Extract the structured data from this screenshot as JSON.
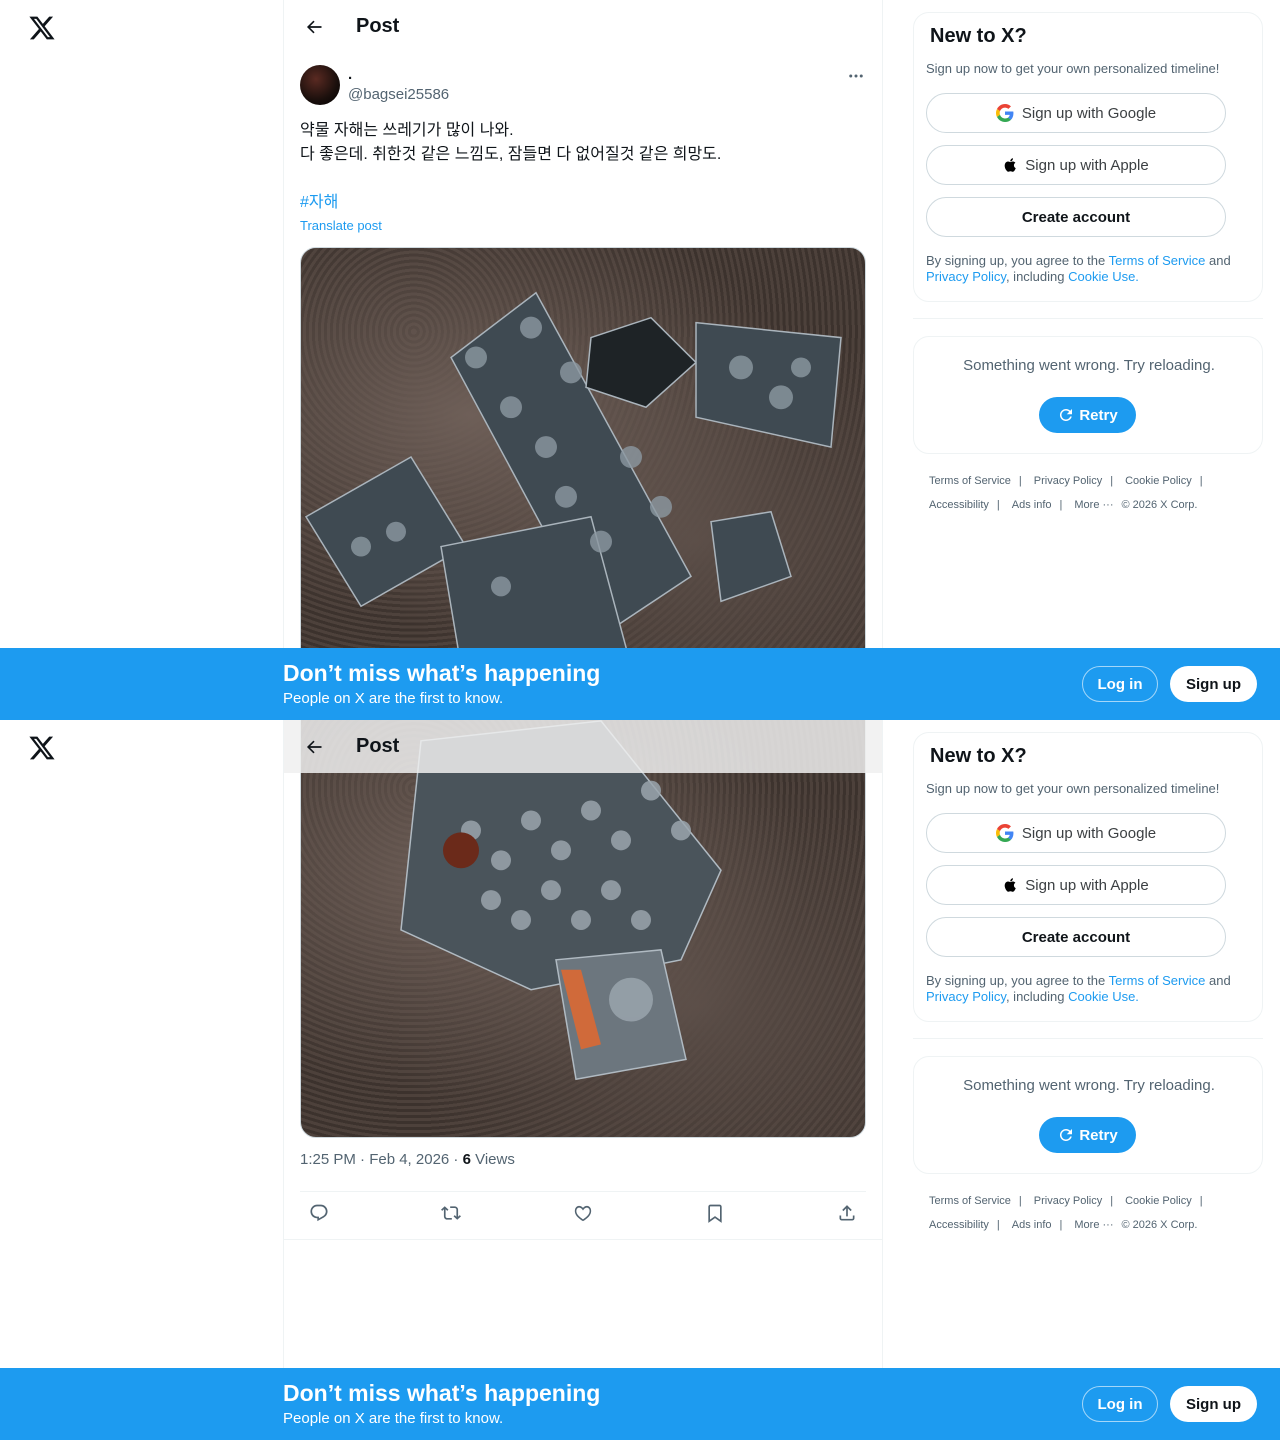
{
  "header": {
    "title": "Post"
  },
  "post": {
    "author_name": ".",
    "author_handle": "@bagsei25586",
    "text": "약물 자해는 쓰레기가 많이 나와.\n다 좋은데. 취한것 같은 느낌도, 잠들면 다 없어질것 같은 희망도.",
    "hashtag": "#자해",
    "translate": "Translate post",
    "time": "1:25 PM · Feb 4, 2026 · ",
    "views_count": "6",
    "views_label": " Views"
  },
  "sidebar": {
    "signup_title": "New to X?",
    "signup_sub": "Sign up now to get your own personalized timeline!",
    "google_label": "Sign up with Google",
    "apple_label": "Sign up with Apple",
    "create_label": "Create account",
    "legal_pre": "By signing up, you agree to the ",
    "terms_link": "Terms of Service",
    "legal_and": " and ",
    "privacy_link": "Privacy Policy",
    "legal_mid": ", including ",
    "cookie_link": "Cookie Use.",
    "error_text": "Something went wrong. Try reloading.",
    "retry_label": "Retry"
  },
  "footer": {
    "terms": "Terms of Service",
    "privacy": "Privacy Policy",
    "cookie": "Cookie Policy",
    "accessibility": "Accessibility",
    "ads": "Ads info",
    "more": "More ···",
    "copyright": "© 2026 X Corp."
  },
  "banner": {
    "title": "Don’t miss what’s happening",
    "subtitle": "People on X are the first to know.",
    "login": "Log in",
    "signup": "Sign up"
  },
  "colors": {
    "accent": "#1d9bf0",
    "text": "#0f1419",
    "muted": "#536471",
    "border": "#eff3f4"
  },
  "icons": [
    "x-logo-icon",
    "back-arrow-icon",
    "more-icon",
    "google-icon",
    "apple-icon",
    "refresh-icon",
    "reply-icon",
    "repost-icon",
    "like-icon",
    "bookmark-icon",
    "share-icon"
  ]
}
